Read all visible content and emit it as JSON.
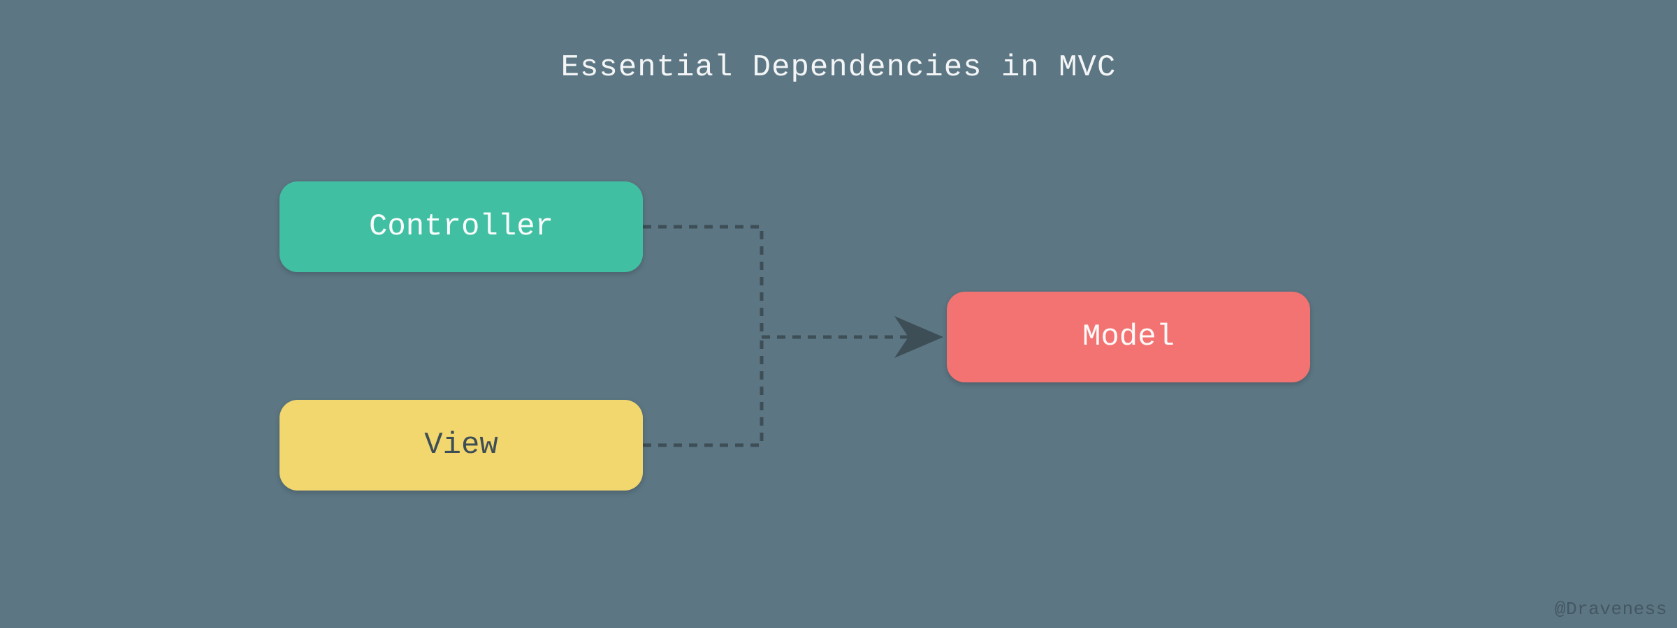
{
  "title": "Essential Dependencies in MVC",
  "nodes": {
    "controller": {
      "label": "Controller"
    },
    "view": {
      "label": "View"
    },
    "model": {
      "label": "Model"
    }
  },
  "colors": {
    "background": "#5c7683",
    "controller": "#41bfa3",
    "view": "#f2d76e",
    "model": "#f27371",
    "connector": "#3d4e56",
    "title_text": "#f3f5f6"
  },
  "edges": [
    {
      "from": "controller",
      "to": "model",
      "style": "dashed"
    },
    {
      "from": "view",
      "to": "model",
      "style": "dashed"
    }
  ],
  "attribution": "@Draveness"
}
